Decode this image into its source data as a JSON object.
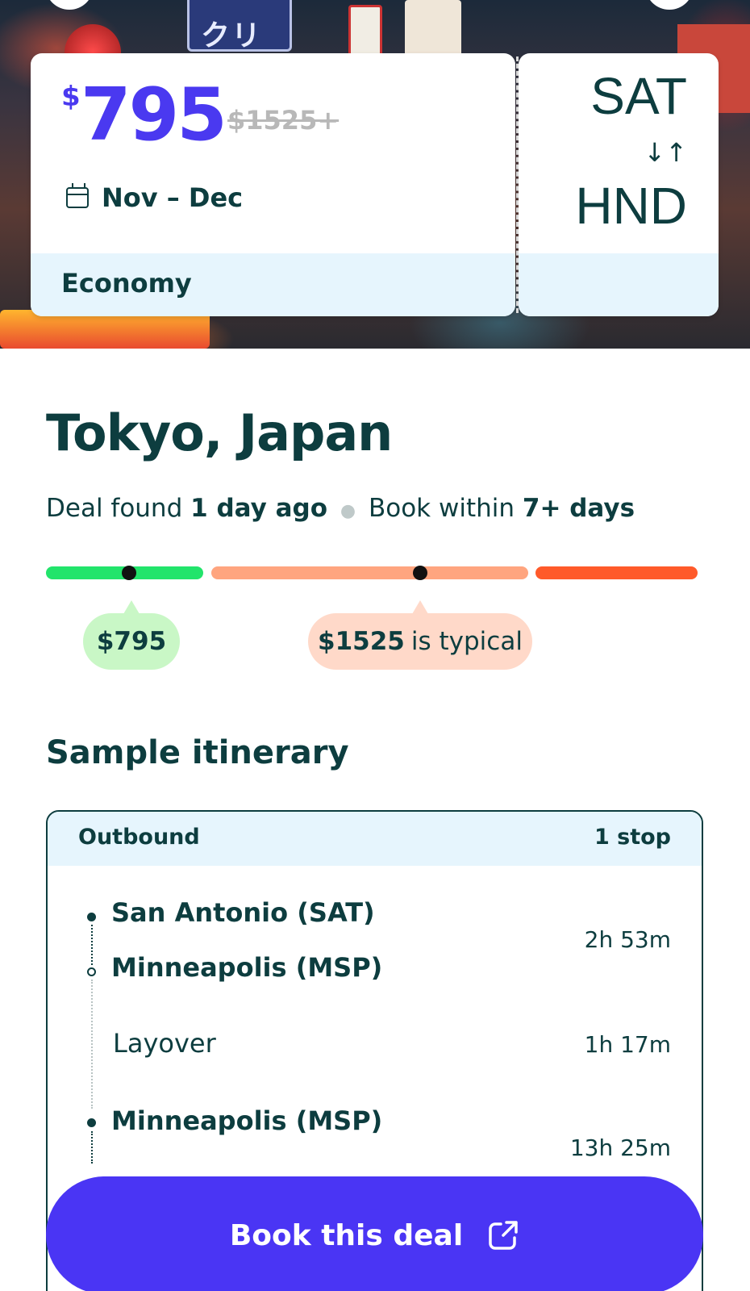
{
  "hero": {
    "price": "795",
    "currency_symbol": "$",
    "original_price": "$1525+",
    "dates": "Nov – Dec",
    "cabin": "Economy",
    "origin": "SAT",
    "destination": "HND",
    "swap_glyph": "↓↑",
    "sign_text": "クリス"
  },
  "deal": {
    "city": "Tokyo, Japan",
    "found_prefix": "Deal found",
    "found_value": "1 day ago",
    "book_prefix": "Book within",
    "book_value": "7+ days"
  },
  "price_bar": {
    "deal_label": "$795",
    "typical_value": "$1525",
    "typical_suffix": "is typical",
    "colors": {
      "good": "#22e46b",
      "typical": "#ffa57f",
      "high": "#ff5a2a"
    }
  },
  "itinerary": {
    "title": "Sample itinerary",
    "direction": "Outbound",
    "stops": "1 stop",
    "leg1_from": "San Antonio (SAT)",
    "leg1_to": "Minneapolis (MSP)",
    "leg1_duration": "2h 53m",
    "layover_label": "Layover",
    "layover_duration": "1h 17m",
    "leg2_from": "Minneapolis (MSP)",
    "leg2_duration": "13h 25m"
  },
  "cta": {
    "label": "Book this deal",
    "icon": "external-link-icon",
    "color": "#4a35f4"
  }
}
